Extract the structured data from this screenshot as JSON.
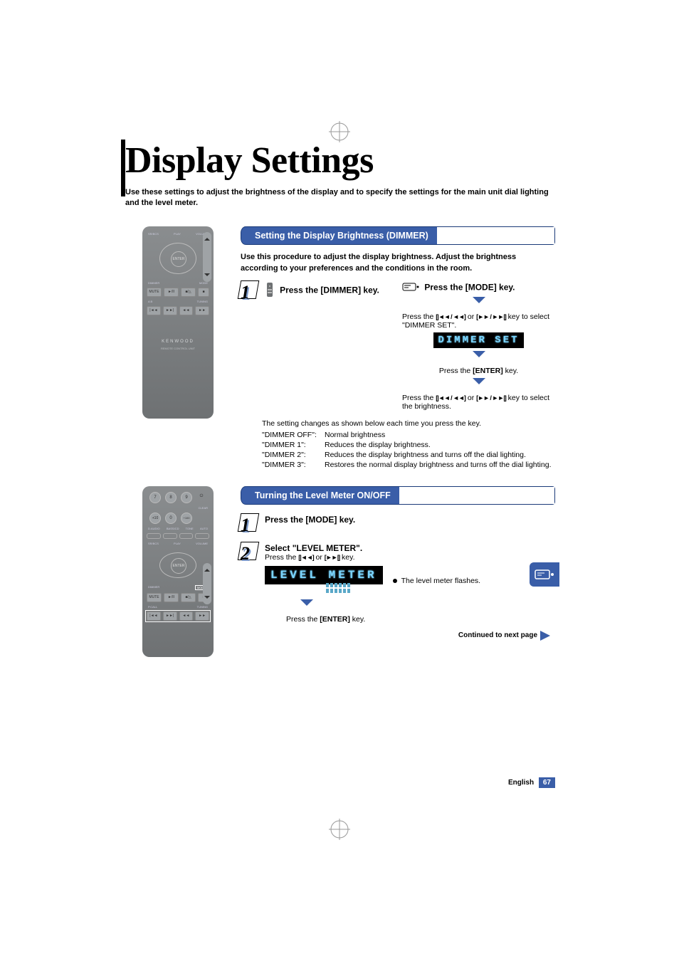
{
  "page": {
    "title": "Display Settings",
    "subtitle": "Use these settings to adjust the brightness of the display and to specify the settings for the main unit dial lighting and the level meter."
  },
  "section1": {
    "heading": "Setting the Display Brightness (DIMMER)",
    "intro": "Use this procedure to adjust the display brightness. Adjust the brightness according to your preferences and the conditions in the room.",
    "step1_left": "Press the [DIMMER] key.",
    "step1_right_head": "Press the [MODE] key.",
    "step1_right_a_pre": "Press the ",
    "step1_right_a_keys": "[|◄◄ / ◄◄]",
    "step1_right_a_mid": " or ",
    "step1_right_a_keys2": "[►► / ►►|]",
    "step1_right_a_post": " key to select \"DIMMER SET\".",
    "lcd1": "DIMMER SET",
    "press_enter": "Press the [ENTER] key.",
    "step1_right_b_pre": "Press the ",
    "step1_right_b_post": " key to select the brightness.",
    "change_note": "The setting changes as shown below each time you press the key.",
    "rows": [
      {
        "k": "\"DIMMER OFF\":",
        "v": "Normal brightness"
      },
      {
        "k": "\"DIMMER 1\":",
        "v": "Reduces the display brightness."
      },
      {
        "k": "\"DIMMER 2\":",
        "v": "Reduces the display brightness and turns off the dial lighting."
      },
      {
        "k": "\"DIMMER 3\":",
        "v": "Restores the normal display brightness and turns off the dial lighting."
      }
    ]
  },
  "section2": {
    "heading": "Turning the Level Meter ON/OFF",
    "step1": "Press the [MODE] key.",
    "step2": "Select \"LEVEL METER\".",
    "step2_sub_pre": "Press the ",
    "step2_sub_keys1": "[|◄◄]",
    "step2_sub_mid": " or ",
    "step2_sub_keys2": "[►►|]",
    "step2_sub_post": " key.",
    "lcd2": "LEVEL METER",
    "meter_note": "The level meter flashes.",
    "press_enter": "Press the [ENTER] key.",
    "continued": "Continued to next page"
  },
  "remote": {
    "brand": "KENWOOD",
    "brand_sub": "REMOTE CONTROL UNIT",
    "enter": "ENTER",
    "mode": "MODE"
  },
  "footer": {
    "lang": "English",
    "page": "67"
  }
}
